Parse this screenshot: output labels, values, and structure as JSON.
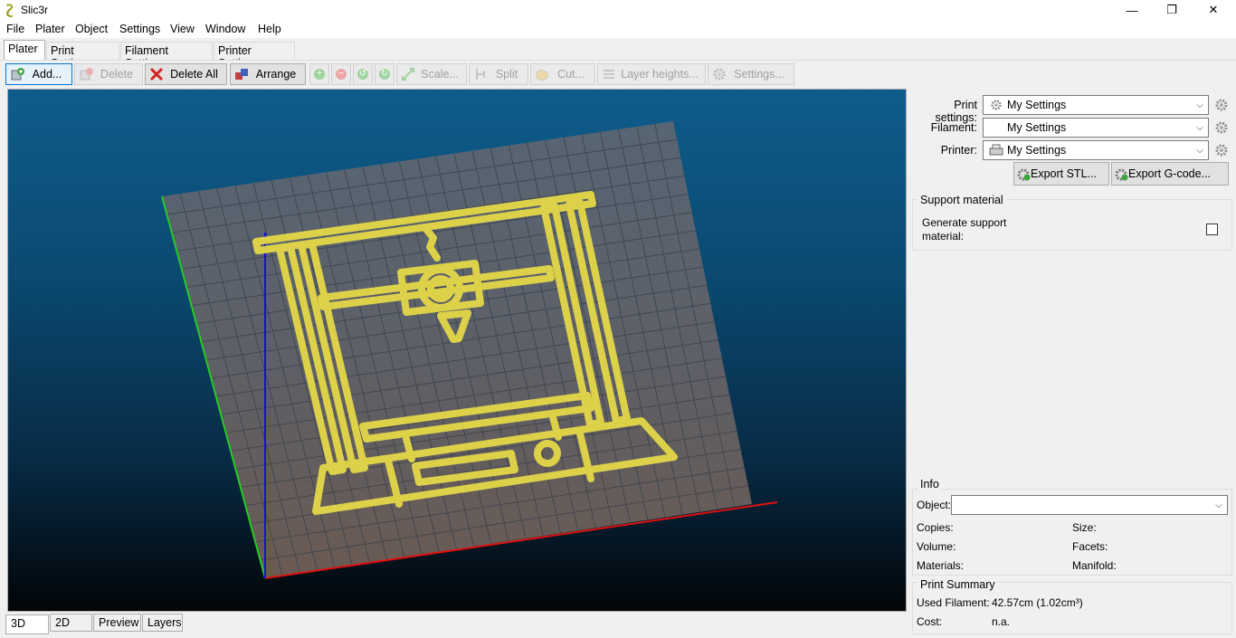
{
  "window": {
    "title": "Slic3r",
    "minimize": "—",
    "maximize": "❐",
    "close": "✕"
  },
  "menu": [
    "File",
    "Plater",
    "Object",
    "Settings",
    "View",
    "Window",
    "Help"
  ],
  "tabs": [
    "Plater",
    "Print Settings",
    "Filament Settings",
    "Printer Settings"
  ],
  "toolbar": {
    "add": "Add...",
    "delete": "Delete",
    "delete_all": "Delete All",
    "arrange": "Arrange",
    "scale": "Scale...",
    "split": "Split",
    "cut": "Cut...",
    "layer_heights": "Layer heights...",
    "settings": "Settings..."
  },
  "view_tabs": [
    "3D",
    "2D",
    "Preview",
    "Layers"
  ],
  "presets": {
    "print_label": "Print settings:",
    "print_value": "My Settings",
    "filament_label": "Filament:",
    "filament_value": "My Settings",
    "printer_label": "Printer:",
    "printer_value": "My Settings"
  },
  "export": {
    "stl": "Export STL...",
    "gcode": "Export G-code..."
  },
  "support": {
    "title": "Support material",
    "generate_label_1": "Generate support",
    "generate_label_2": "material:"
  },
  "info": {
    "title": "Info",
    "object_label": "Object:",
    "copies": "Copies:",
    "size": "Size:",
    "volume": "Volume:",
    "facets": "Facets:",
    "materials": "Materials:",
    "manifold": "Manifold:"
  },
  "summary": {
    "title": "Print Summary",
    "used_filament_label": "Used Filament:",
    "used_filament_value": "42.57cm (1.02cm³)",
    "cost_label": "Cost:",
    "cost_value": "n.a."
  },
  "colors": {
    "model": "#ddd14a",
    "bed": "#5b6470",
    "axis_x": "#e01010",
    "axis_y": "#22cc22",
    "axis_z": "#1010dd"
  }
}
